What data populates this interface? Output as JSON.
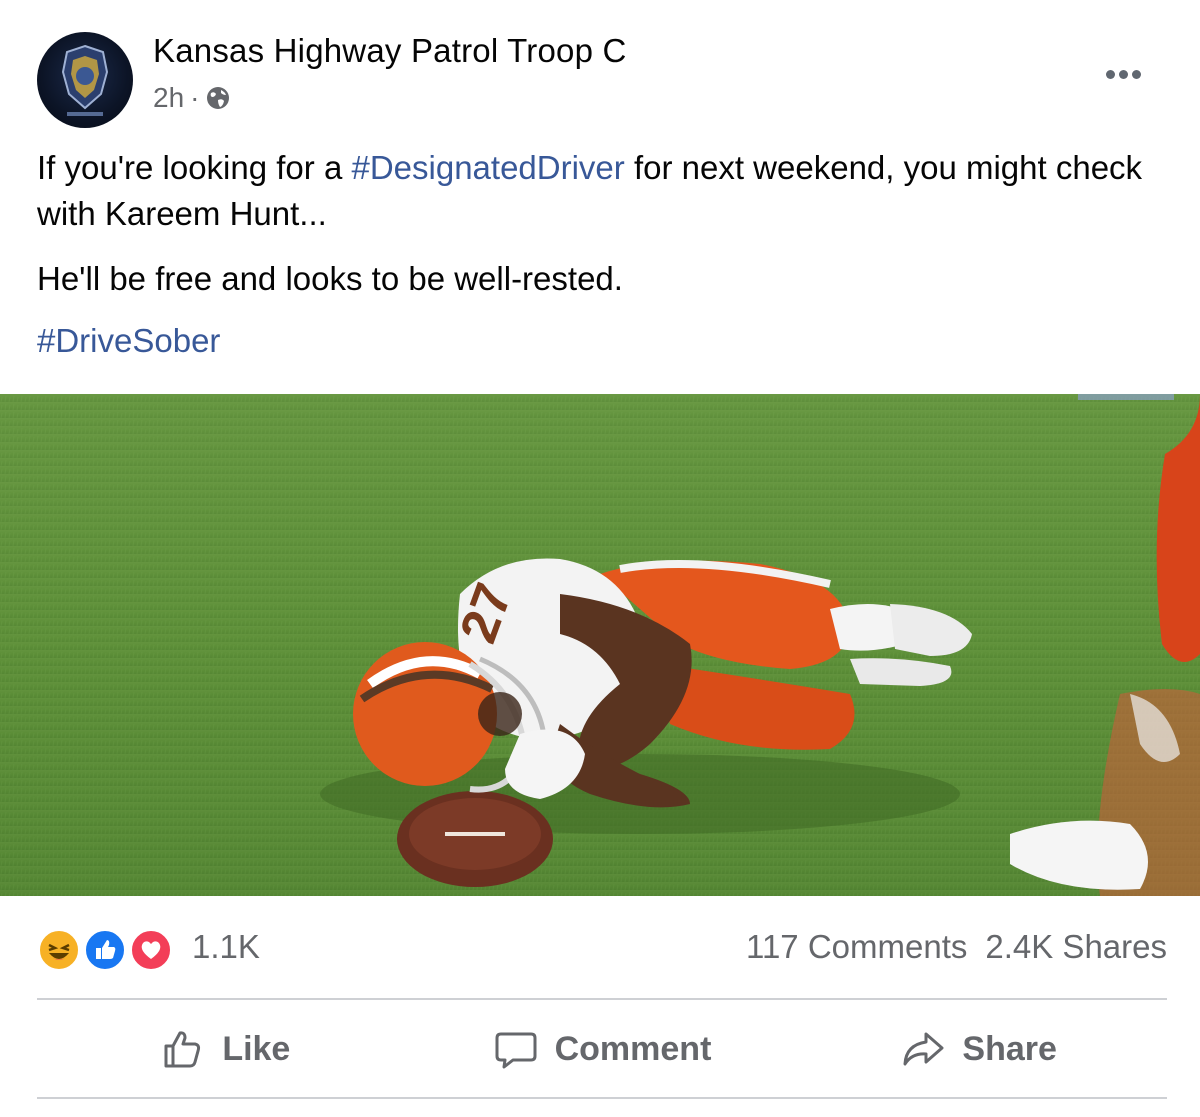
{
  "post": {
    "page_name": "Kansas Highway Patrol Troop C",
    "time": "2h",
    "separator": "·",
    "audience_icon": "globe-icon",
    "more_icon": "more-options-icon",
    "text": {
      "p1_before": "If you're looking for a ",
      "p1_hashtag": "#DesignatedDriver",
      "p1_after": " for next weekend, you might check with Kareem Hunt...",
      "p2": "He'll be free and looks to be well-rested.",
      "p3_hashtag": "#DriveSober"
    },
    "hashtag_color": "#385898"
  },
  "reactions": {
    "icons": [
      "haha-reaction-icon",
      "like-reaction-icon",
      "love-reaction-icon"
    ],
    "count": "1.1K",
    "comments": "117 Comments",
    "shares": "2.4K Shares"
  },
  "actions": {
    "like": "Like",
    "comment": "Comment",
    "share": "Share"
  },
  "colors": {
    "secondary_text": "#65676b",
    "like_blue": "#1877f2",
    "love_red": "#f33e58",
    "haha_yellow": "#f7b125"
  }
}
